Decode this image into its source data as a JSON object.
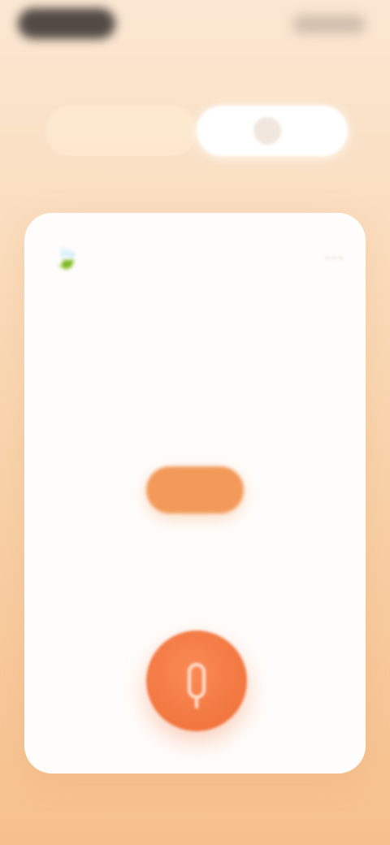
{
  "status": {
    "left_label": "",
    "right_label": ""
  },
  "segmented_control": {
    "left_label": "",
    "right_label": ""
  },
  "card": {
    "headline": "",
    "subtext": "",
    "pill_label": "",
    "caption": ""
  },
  "icons": {
    "leaf": "leaf-icon",
    "more": "more-icon",
    "mic": "microphone-icon"
  },
  "colors": {
    "background_top": "#FBE7D2",
    "background_bottom": "#F6C08C",
    "accent_orange": "#F2763F",
    "headline": "#E06B48",
    "pill": "#F39A5A",
    "card": "#FFFDFB"
  }
}
